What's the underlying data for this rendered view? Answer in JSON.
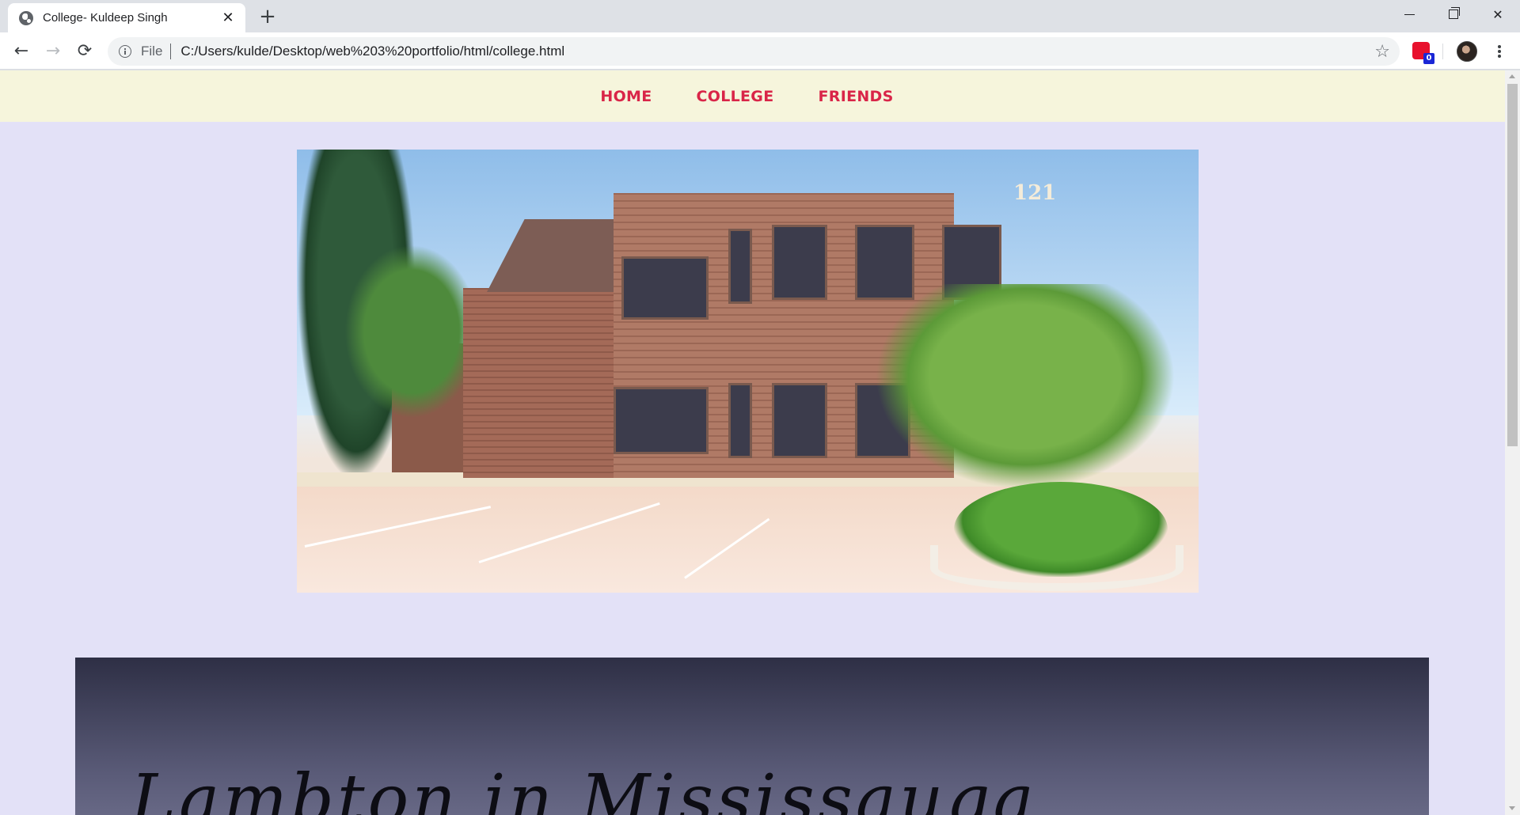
{
  "browser": {
    "tab": {
      "title": "College- Kuldeep Singh",
      "close": "✕",
      "favicon": "globe-icon"
    },
    "new_tab": "+",
    "window_controls": [
      "minimize-icon",
      "restore-icon",
      "close-icon"
    ],
    "window_close": "✕",
    "nav": {
      "back": "←",
      "forward": "→",
      "reload": "⟳"
    },
    "address": {
      "scheme_label": "File",
      "url": "C:/Users/kulde/Desktop/web%203%20portfolio/html/college.html",
      "star": "☆"
    },
    "extension_badge": "0"
  },
  "site": {
    "nav": [
      {
        "label": "HOME"
      },
      {
        "label": "COLLEGE"
      },
      {
        "label": "FRIENDS"
      }
    ],
    "hero_image": {
      "sign_text": "121"
    },
    "panel_heading": "Lambton in Mississauga"
  },
  "colors": {
    "nav_bg": "#f6f5dc",
    "nav_link": "#d92548",
    "page_bg": "#e3e1f7",
    "panel_top": "#2e2f45"
  }
}
